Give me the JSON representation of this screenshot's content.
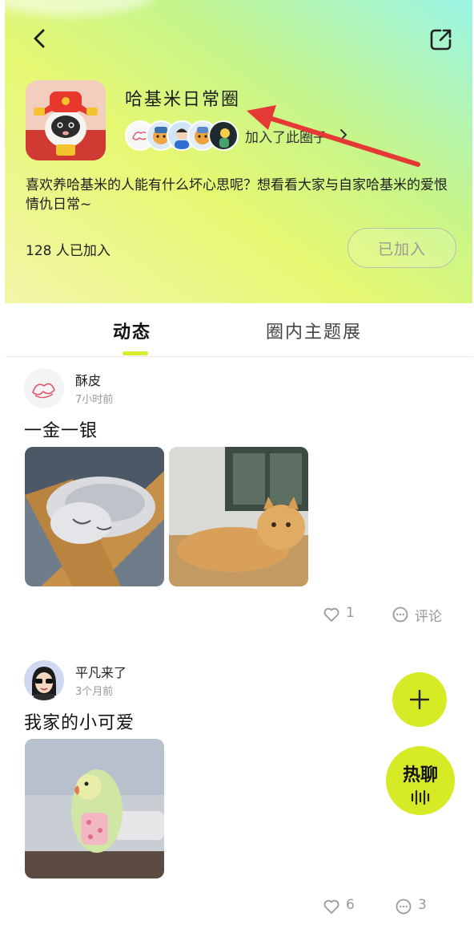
{
  "header": {
    "title": "哈基米日常圈",
    "joined_text": "加入了此圈子",
    "description": "喜欢养哈基米的人能有什么坏心思呢？想看看大家与自家哈基米的爱恨情仇日常~",
    "member_count": "128 人已加入",
    "joined_button": "已加入",
    "back_icon": "chevron-left-icon",
    "share_icon": "share-icon"
  },
  "tabs": [
    {
      "label": "动态",
      "active": true
    },
    {
      "label": "圈内主题展",
      "active": false
    }
  ],
  "posts": [
    {
      "author": "酥皮",
      "time": "7小时前",
      "text": "一金一银",
      "likes": "1",
      "comments": "评论"
    },
    {
      "author": "平凡来了",
      "time": "3个月前",
      "text": "我家的小可爱",
      "likes": "6",
      "comments": "3"
    }
  ],
  "fab": {
    "add_icon": "plus-icon",
    "hot_chat_label": "热聊"
  },
  "colors": {
    "accent": "#d6ea26",
    "annotation_arrow": "#e53935"
  }
}
